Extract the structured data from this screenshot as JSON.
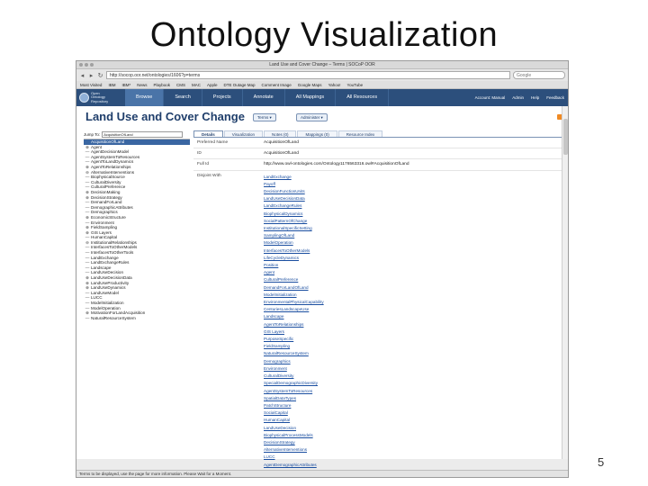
{
  "slide": {
    "title": "Ontology Visualization",
    "number": "5"
  },
  "browser": {
    "window_title": "Land Use and Cover Change – Terms | SOCoP OOR",
    "url": "http://socop.oor.net/ontologies/1606?p=terms",
    "search_placeholder": "Google",
    "status_text": "Terms to be displayed, use the page for more information. Please Wait for a Moment.",
    "bookmarks": [
      "Most Visited",
      "IBM",
      "IBM*",
      "News",
      "Playbook",
      "CMS",
      "MAC",
      "Apple",
      "DTE Outage Map",
      "Comment Image",
      "Google Maps",
      "Yahoo!",
      "YouTube"
    ]
  },
  "app": {
    "logo_lines": [
      "Open",
      "Ontology",
      "Repository"
    ],
    "nav": [
      "Browse",
      "Search",
      "Projects",
      "Annotate",
      "All Mappings",
      "All Resources"
    ],
    "user_links": [
      "Account: Manual",
      "Admin",
      "Help",
      "Feedback"
    ]
  },
  "ontology": {
    "title": "Land Use and Cover Change",
    "terms_button": "Terms ▾",
    "admin_button": "Administer ▾",
    "jump_label": "Jump To:",
    "jump_value": "AcquisitionOfLand"
  },
  "tree_items": [
    {
      "t": "",
      "label": "AcquisitionOfLand",
      "sel": true
    },
    {
      "t": "⊕",
      "label": "Agent"
    },
    {
      "t": "—",
      "label": "AgentDecisionModel"
    },
    {
      "t": "—",
      "label": "AgentSystemToResources"
    },
    {
      "t": "—",
      "label": "AgentToLandDynamics"
    },
    {
      "t": "⊕",
      "label": "AgentToRelationships"
    },
    {
      "t": "⊖",
      "label": "AlternativeInterventions"
    },
    {
      "t": "—",
      "label": "BiophysicalSource"
    },
    {
      "t": "—",
      "label": "CulturalDiversity"
    },
    {
      "t": "—",
      "label": "CulturalPreference"
    },
    {
      "t": "⊕",
      "label": "DecisionMaking"
    },
    {
      "t": "⊕",
      "label": "DecisionStrategy"
    },
    {
      "t": "—",
      "label": "DemandForLand"
    },
    {
      "t": "—",
      "label": "DemographicAttributes"
    },
    {
      "t": "—",
      "label": "Demographics"
    },
    {
      "t": "⊕",
      "label": "EconomicStructure"
    },
    {
      "t": "—",
      "label": "Environment"
    },
    {
      "t": "⊕",
      "label": "FieldSampling"
    },
    {
      "t": "⊕",
      "label": "GIS Layers"
    },
    {
      "t": "—",
      "label": "HumanCapital"
    },
    {
      "t": "⊖",
      "label": "InstitutionalRelationships"
    },
    {
      "t": "—",
      "label": "InterfacesToOtherModels"
    },
    {
      "t": "—",
      "label": "InterfacesToOtherTools"
    },
    {
      "t": "—",
      "label": "LandExchange"
    },
    {
      "t": "—",
      "label": "LandExchangeRules"
    },
    {
      "t": "—",
      "label": "Landscape"
    },
    {
      "t": "—",
      "label": "LandUseDecision"
    },
    {
      "t": "⊕",
      "label": "LandUseDecisionData"
    },
    {
      "t": "⊕",
      "label": "LandUseProductivity"
    },
    {
      "t": "⊕",
      "label": "LandUseDynamics"
    },
    {
      "t": "—",
      "label": "LandUseModel"
    },
    {
      "t": "—",
      "label": "LUCC"
    },
    {
      "t": "—",
      "label": "ModelInitialization"
    },
    {
      "t": "—",
      "label": "ModelOperation"
    },
    {
      "t": "⊕",
      "label": "MotivationForLandAcquisition"
    },
    {
      "t": "—",
      "label": "NaturalResourceSystem"
    }
  ],
  "detail": {
    "tabs": [
      "Details",
      "Visualization",
      "Notes (0)",
      "Mappings (0)",
      "Resource Index"
    ],
    "preferred_name_label": "Preferred Name",
    "preferred_name": "AcquisitionOfLand",
    "id_label": "ID",
    "id": "AcquisitionOfLand",
    "full_id_label": "Full Id",
    "full_id": "http://www.owl-ontologies.com/Ontology1176563316.owl#AcquisitionOfLand",
    "disjoint_label": "Disjoint With",
    "disjoint_with": [
      "LandExchange",
      "Payoff",
      "DecisionFunctionUnits",
      "LandUseDecisionData",
      "LandExchangeRules",
      "BiophysicalDynamics",
      "SocialPatternOfChange",
      "InstitutionalSpecificSetting",
      "SamplingOfLand",
      "ModelOperation",
      "InterfacesToOtherModels",
      "LifeCycleDynamics",
      "Position",
      "Agent",
      "CulturalPreference",
      "DemandForLandOfLand",
      "ModelInitialization",
      "EnvironmentalPhysicalCapability",
      "CenturiesLandscapeUse",
      "Landscape",
      "AgentToRelationships",
      "GIS Layers",
      "PurposeSpecific",
      "FieldSampling",
      "NaturalResourceSystem",
      "Demographics",
      "Environment",
      "CulturalDiversity",
      "SpecialDemographicDiversity",
      "AgentSystemToResources",
      "SpatialDataTypes",
      "PatchStructure",
      "SocialCapital",
      "HumanCapital",
      "LandUseDecision",
      "BiophysicalProcessModels",
      "DecisionStrategy",
      "AlternativeInterventions",
      "LUCC",
      "AgentDemographicAttributes",
      "PotentialLandUse",
      "MotivationForLandSupply"
    ]
  }
}
